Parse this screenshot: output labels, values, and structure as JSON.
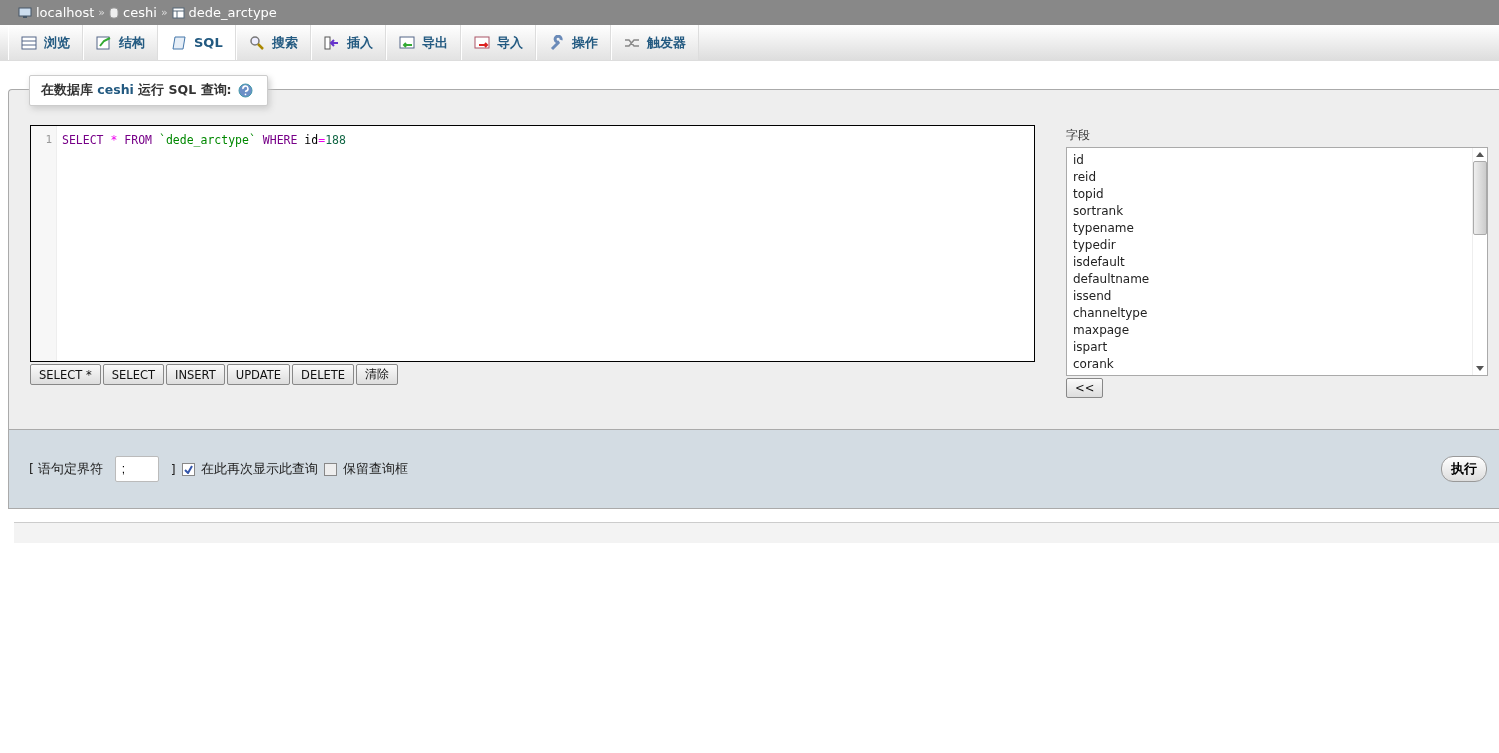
{
  "breadcrumb": [
    {
      "kind": "server",
      "label": "localhost"
    },
    {
      "kind": "database",
      "label": "ceshi"
    },
    {
      "kind": "table",
      "label": "dede_arctype"
    }
  ],
  "breadcrumb_separator": "»",
  "tabs": [
    {
      "kind": "browse",
      "label": "浏览",
      "selected": false
    },
    {
      "kind": "structure",
      "label": "结构",
      "selected": false
    },
    {
      "kind": "sql",
      "label": "SQL",
      "selected": true
    },
    {
      "kind": "search",
      "label": "搜索",
      "selected": false
    },
    {
      "kind": "insert",
      "label": "插入",
      "selected": false
    },
    {
      "kind": "export",
      "label": "导出",
      "selected": false
    },
    {
      "kind": "import",
      "label": "导入",
      "selected": false
    },
    {
      "kind": "operations",
      "label": "操作",
      "selected": false
    },
    {
      "kind": "triggers",
      "label": "触发器",
      "selected": false
    }
  ],
  "legend": {
    "text": "在数据库 **ceshi** 运行 SQL 查询:"
  },
  "editor": {
    "line_numbers": [
      "1"
    ],
    "tokens": [
      {
        "kind": "keyword",
        "text": "SELECT "
      },
      {
        "kind": "operator",
        "text": "* "
      },
      {
        "kind": "keyword",
        "text": "FROM "
      },
      {
        "kind": "string",
        "text": "`dede_arctype` "
      },
      {
        "kind": "keyword",
        "text": "WHERE "
      },
      {
        "kind": "plain",
        "text": "id"
      },
      {
        "kind": "operator",
        "text": "="
      },
      {
        "kind": "number",
        "text": "188"
      }
    ]
  },
  "query_buttons": [
    "SELECT *",
    "SELECT",
    "INSERT",
    "UPDATE",
    "DELETE",
    "清除"
  ],
  "fields": {
    "label": "字段",
    "items": [
      "id",
      "reid",
      "topid",
      "sortrank",
      "typename",
      "typedir",
      "isdefault",
      "defaultname",
      "issend",
      "channeltype",
      "maxpage",
      "ispart",
      "corank"
    ],
    "insert_button": "<<"
  },
  "options": {
    "bracket_open": "[ 语句定界符",
    "delimiter": ";",
    "bracket_close": "]",
    "show_again": {
      "label": "在此再次显示此查询",
      "checked": true
    },
    "retain_box": {
      "label": "保留查询框",
      "checked": false
    }
  },
  "go_button": "执行"
}
